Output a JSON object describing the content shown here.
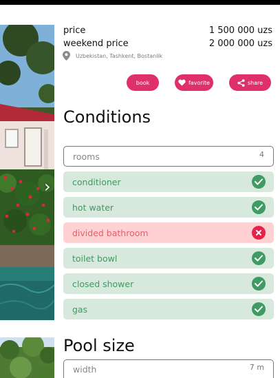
{
  "pricing": {
    "price_label": "price",
    "price_value": "1 500 000 uzs",
    "weekend_label": "weekend price",
    "weekend_value": "2 000 000 uzs"
  },
  "location": {
    "icon": "location-pin-icon",
    "text": "Uzbekistan, Tashkent, Bostanlik"
  },
  "actions": {
    "book_label": "book",
    "favorite_label": "favorite",
    "share_label": "share",
    "accent_color": "#e0306b"
  },
  "conditions": {
    "title": "Conditions",
    "rooms": {
      "label": "rooms",
      "value": "4"
    },
    "items": [
      {
        "label": "conditioner",
        "status": "yes"
      },
      {
        "label": "hot water",
        "status": "yes"
      },
      {
        "label": "divided bathroom",
        "status": "no"
      },
      {
        "label": "toilet bowl",
        "status": "yes"
      },
      {
        "label": "closed shower",
        "status": "yes"
      },
      {
        "label": "gas",
        "status": "yes"
      }
    ],
    "colors": {
      "yes_bg": "#d6e9dc",
      "yes_fg": "#3f9a63",
      "no_bg": "#ffd1d3",
      "no_fg": "#e4234a"
    }
  },
  "pool": {
    "title": "Pool size",
    "width": {
      "label": "width",
      "value": "7 m"
    }
  },
  "gallery": {
    "photos": [
      "house-exterior-photo",
      "garden-photo"
    ],
    "next_icon": "chevron-right-icon"
  }
}
